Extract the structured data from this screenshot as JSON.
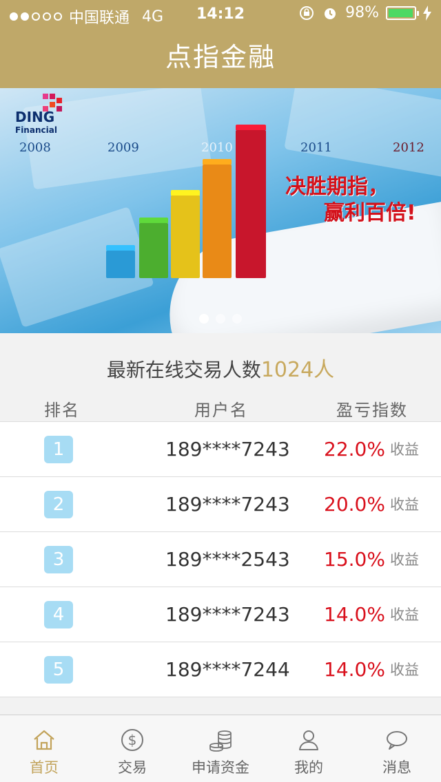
{
  "status_bar": {
    "carrier": "中国联通",
    "network": "4G",
    "time": "14:12",
    "battery": "98%",
    "battery_level": 0.98
  },
  "header": {
    "title": "点指金融"
  },
  "banner": {
    "brand": "DING",
    "brand_sub": "Financial",
    "years": [
      "2008",
      "2009",
      "2010",
      "2011",
      "2012"
    ],
    "slogan_line1": "决胜期指，",
    "slogan_line2": "赢利百倍!",
    "slides": 3,
    "active_slide": 1
  },
  "online": {
    "label": "最新在线交易人数",
    "count": "1024人"
  },
  "table": {
    "headers": {
      "rank": "排名",
      "user": "用户名",
      "index": "盈亏指数"
    },
    "rows": [
      {
        "rank": "1",
        "user": "189****7243",
        "pct": "22.0%",
        "suffix": "收益"
      },
      {
        "rank": "2",
        "user": "189****7243",
        "pct": "20.0%",
        "suffix": "收益"
      },
      {
        "rank": "3",
        "user": "189****2543",
        "pct": "15.0%",
        "suffix": "收益"
      },
      {
        "rank": "4",
        "user": "189****7243",
        "pct": "14.0%",
        "suffix": "收益"
      },
      {
        "rank": "5",
        "user": "189****7244",
        "pct": "14.0%",
        "suffix": "收益"
      }
    ]
  },
  "tabbar": {
    "items": [
      {
        "label": "首页",
        "icon": "home-icon",
        "active": true
      },
      {
        "label": "交易",
        "icon": "dollar-icon",
        "active": false
      },
      {
        "label": "申请资金",
        "icon": "coins-icon",
        "active": false
      },
      {
        "label": "我的",
        "icon": "person-icon",
        "active": false
      },
      {
        "label": "消息",
        "icon": "chat-icon",
        "active": false
      }
    ]
  },
  "colors": {
    "gold": "#bfa869",
    "accent_gold": "#c8a95e",
    "red": "#d9101c",
    "rank_blue": "#a7dcf4"
  }
}
